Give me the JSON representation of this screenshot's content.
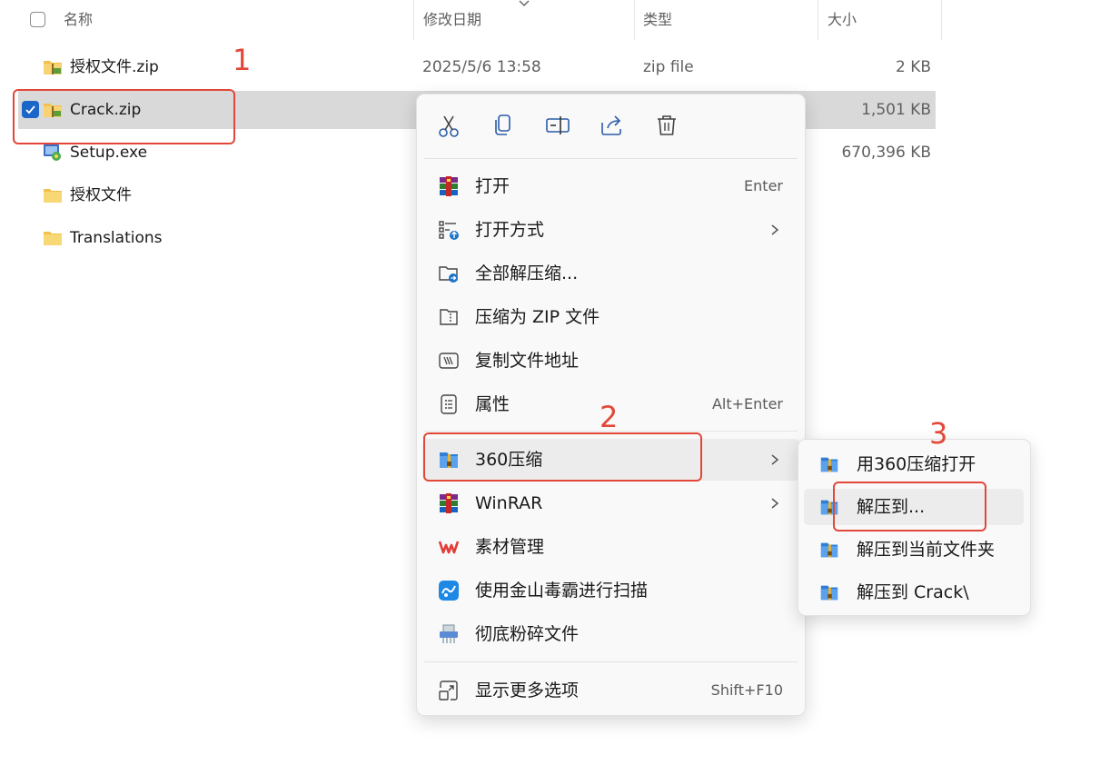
{
  "header": {
    "col_name": "名称",
    "col_date": "修改日期",
    "col_type": "类型",
    "col_size": "大小"
  },
  "files": [
    {
      "name": "授权文件.zip",
      "date": "2025/5/6 13:58",
      "type": "zip file",
      "size": "2 KB",
      "icon": "zip-folder-icon",
      "selected": false
    },
    {
      "name": "Crack.zip",
      "date": "",
      "type": "",
      "size": "1,501 KB",
      "icon": "zip-folder-icon",
      "selected": true
    },
    {
      "name": "Setup.exe",
      "date": "",
      "type": "",
      "size": "670,396 KB",
      "icon": "installer-icon",
      "selected": false
    },
    {
      "name": "授权文件",
      "date": "",
      "type": "",
      "size": "",
      "icon": "folder-icon",
      "selected": false
    },
    {
      "name": "Translations",
      "date": "",
      "type": "",
      "size": "",
      "icon": "folder-icon",
      "selected": false
    }
  ],
  "context_menu": {
    "toolbar": [
      "cut-icon",
      "copy-icon",
      "rename-icon",
      "share-icon",
      "delete-icon"
    ],
    "items": [
      {
        "label": "打开",
        "shortcut": "Enter",
        "icon": "winrar-icon"
      },
      {
        "label": "打开方式",
        "shortcut": "",
        "icon": "open-with-icon",
        "submenu": true
      },
      {
        "label": "全部解压缩...",
        "shortcut": "",
        "icon": "extract-all-icon"
      },
      {
        "label": "压缩为 ZIP 文件",
        "shortcut": "",
        "icon": "zip-compress-icon"
      },
      {
        "label": "复制文件地址",
        "shortcut": "",
        "icon": "copy-path-icon"
      },
      {
        "label": "属性",
        "shortcut": "Alt+Enter",
        "icon": "properties-icon"
      },
      {
        "label": "360压缩",
        "shortcut": "",
        "icon": "360zip-icon",
        "submenu": true,
        "highlighted": true
      },
      {
        "label": "WinRAR",
        "shortcut": "",
        "icon": "winrar-icon",
        "submenu": true
      },
      {
        "label": "素材管理",
        "shortcut": "",
        "icon": "wps-icon"
      },
      {
        "label": "使用金山毒霸进行扫描",
        "shortcut": "",
        "icon": "kingsoft-antivirus-icon"
      },
      {
        "label": "彻底粉碎文件",
        "shortcut": "",
        "icon": "shredder-icon"
      },
      {
        "label": "显示更多选项",
        "shortcut": "Shift+F10",
        "icon": "more-options-icon"
      }
    ]
  },
  "submenu_360": {
    "items": [
      {
        "label": "用360压缩打开",
        "icon": "360zip-icon"
      },
      {
        "label": "解压到...",
        "icon": "360zip-icon",
        "highlighted": true
      },
      {
        "label": "解压到当前文件夹",
        "icon": "360zip-icon"
      },
      {
        "label": "解压到 Crack\\",
        "icon": "360zip-icon"
      }
    ]
  },
  "annotations": {
    "step1": "1",
    "step2": "2",
    "step3": "3",
    "color": "#e2473a"
  },
  "colors": {
    "selection": "#d9d9d9",
    "checkbox_accent": "#1a66c9",
    "menu_bg": "#f9f9f9"
  }
}
